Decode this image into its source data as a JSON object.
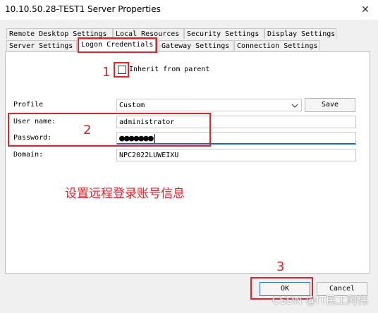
{
  "window": {
    "title": "10.10.50.28-TEST1 Server Properties",
    "close_glyph": "✕"
  },
  "tabs": {
    "row1": [
      "Remote Desktop Settings",
      "Local Resources",
      "Security Settings",
      "Display Settings"
    ],
    "row2": [
      "Server Settings",
      "Logon Credentials",
      "Gateway Settings",
      "Connection Settings"
    ],
    "active": "Logon Credentials"
  },
  "form": {
    "inherit_label": "Inherit from parent",
    "inherit_checked": false,
    "profile_label": "Profile",
    "profile_value": "Custom",
    "save_label": "Save",
    "username_label": "User name:",
    "username_value": "administrator",
    "password_label": "Password:",
    "password_value": "●●●●●●●",
    "domain_label": "Domain:",
    "domain_value": "NPC2022LUWEIXU"
  },
  "buttons": {
    "ok": "OK",
    "cancel": "Cancel"
  },
  "annotations": {
    "markers": [
      "1",
      "2",
      "3"
    ],
    "caption": "设置远程登录账号信息",
    "color": "#e3232c"
  },
  "watermark": "CSDN @IT民工阿伟"
}
